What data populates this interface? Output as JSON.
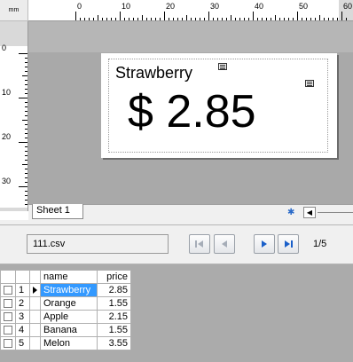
{
  "ruler": {
    "unit": "mm",
    "top_labels": [
      "0",
      "10",
      "20",
      "30",
      "40",
      "50",
      "60"
    ],
    "left_labels": [
      "0",
      "10",
      "20",
      "30"
    ]
  },
  "label": {
    "name_text": "Strawberry",
    "price_text": "$ 2.85"
  },
  "sheet_tabs": {
    "active": "Sheet 1"
  },
  "database": {
    "file_name": "111.csv",
    "record_counter": "1/5",
    "columns": [
      "name",
      "price"
    ],
    "rows": [
      {
        "num": "1",
        "name": "Strawberry",
        "price": "2.85"
      },
      {
        "num": "2",
        "name": "Orange",
        "price": "1.55"
      },
      {
        "num": "3",
        "name": "Apple",
        "price": "2.15"
      },
      {
        "num": "4",
        "name": "Banana",
        "price": "1.55"
      },
      {
        "num": "5",
        "name": "Melon",
        "price": "3.55"
      }
    ],
    "selected_row": 1
  },
  "colors": {
    "selection": "#3399ff",
    "canvas": "#a9a9a9",
    "nav_active": "#1a5fc9",
    "nav_disabled": "#a6adb8"
  },
  "icons": {
    "nav_first": "first-record-icon",
    "nav_prev": "previous-record-icon",
    "nav_next": "next-record-icon",
    "nav_last": "last-record-icon"
  }
}
